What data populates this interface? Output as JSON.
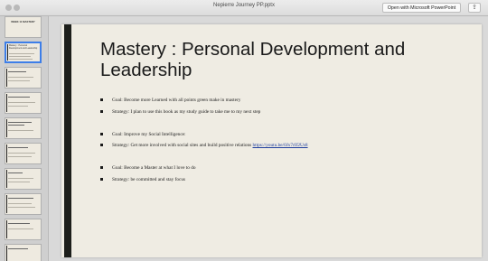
{
  "window": {
    "title": "Nepierre Journey PP.pptx",
    "open_button": "Open with Microsoft PowerPoint"
  },
  "thumbnails": [
    {
      "title": "WEEK 11 MASTERY",
      "selected": false
    },
    {
      "title": "Mastery : Personal Development and Leadership",
      "selected": true
    },
    {
      "title": "",
      "selected": false
    },
    {
      "title": "",
      "selected": false
    },
    {
      "title": "",
      "selected": false
    },
    {
      "title": "",
      "selected": false
    },
    {
      "title": "",
      "selected": false
    },
    {
      "title": "",
      "selected": false
    },
    {
      "title": "",
      "selected": false
    },
    {
      "title": "",
      "selected": false
    }
  ],
  "slide": {
    "title": "Mastery : Personal Development and Leadership",
    "bullets": [
      {
        "text": "Goal: Become more Learned with all points green make in mastery",
        "link": ""
      },
      {
        "text": "Strategy: I plan to use this book  as my  study guide to take me to my next step",
        "link": ""
      },
      {
        "text": "Goal: Improve my Social Intelligence:",
        "link": ""
      },
      {
        "text": "Strategy: Get more involved with social sites and build positive relations ",
        "link": "https://youtu.be/0Jx7rIf2Us8"
      },
      {
        "text": "Goal: Become a Master at what I love to do",
        "link": ""
      },
      {
        "text": "Strategy: be committed and stay focus",
        "link": ""
      }
    ]
  }
}
